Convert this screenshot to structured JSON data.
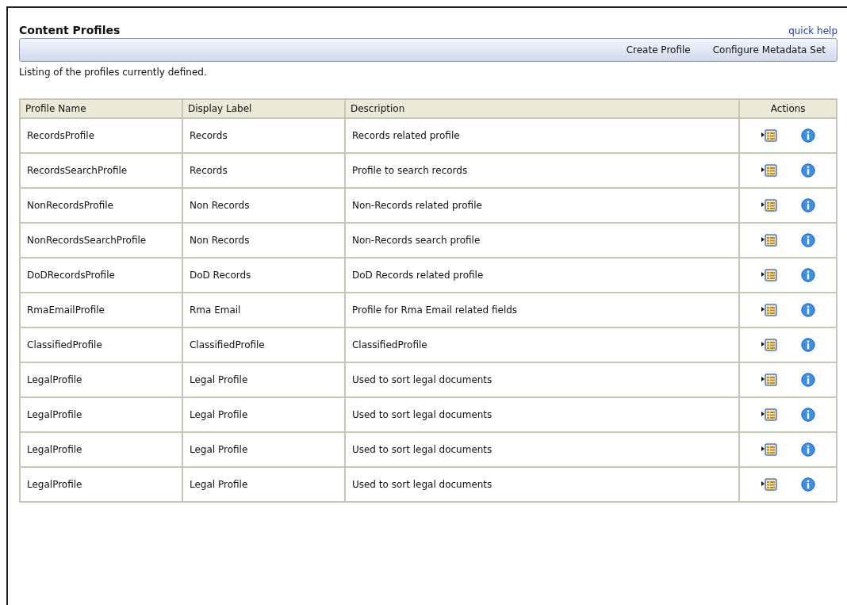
{
  "title": "Content Profiles",
  "quick_help": "quick help",
  "toolbar": [
    "Create Profile",
    "Configure Metadata Set"
  ],
  "intro": "Listing of the profiles currently defined.",
  "table": {
    "columns": [
      "Profile Name",
      "Display Label",
      "Description",
      "Actions"
    ],
    "rows": [
      {
        "name": "RecordsProfile",
        "label": "Records",
        "description": "Records related profile"
      },
      {
        "name": "RecordsSearchProfile",
        "label": "Records",
        "description": "Profile to search records"
      },
      {
        "name": "NonRecordsProfile",
        "label": "Non Records",
        "description": "Non-Records related profile"
      },
      {
        "name": "NonRecordsSearchProfile",
        "label": "Non Records",
        "description": "Non-Records search profile"
      },
      {
        "name": "DoDRecordsProfile",
        "label": "DoD Records",
        "description": "DoD Records related profile"
      },
      {
        "name": "RmaEmailProfile",
        "label": "Rma Email",
        "description": "Profile for Rma Email related fields"
      },
      {
        "name": "ClassifiedProfile",
        "label": "ClassifiedProfile",
        "description": "ClassifiedProfile"
      },
      {
        "name": "LegalProfile",
        "label": "Legal Profile",
        "description": "Used to sort legal documents"
      },
      {
        "name": "LegalProfile",
        "label": "Legal Profile",
        "description": "Used to sort legal documents"
      },
      {
        "name": "LegalProfile",
        "label": "Legal Profile",
        "description": "Used to sort legal documents"
      },
      {
        "name": "LegalProfile",
        "label": "Legal Profile",
        "description": "Used to sort legal documents"
      }
    ]
  }
}
